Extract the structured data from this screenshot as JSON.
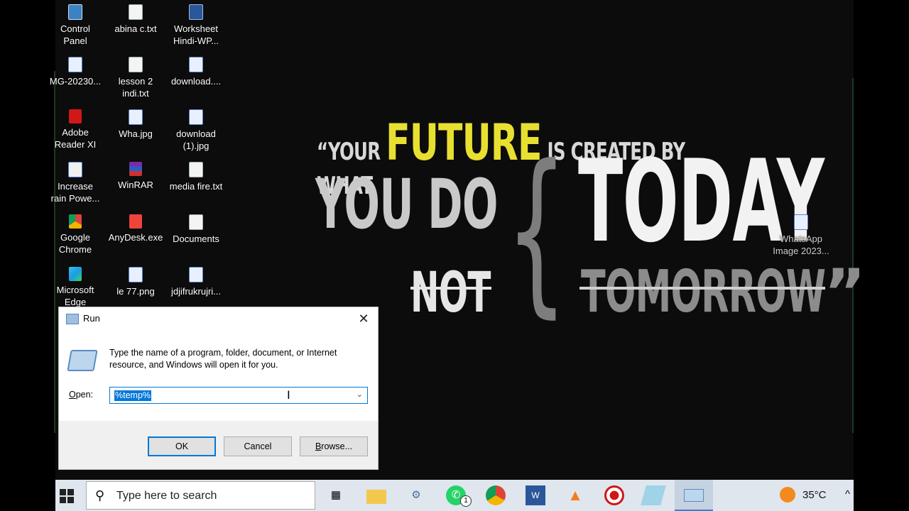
{
  "wallpaper": {
    "open_quote": "“YOUR",
    "future": "FUTURE",
    "created": "IS CREATED BY WHAT",
    "you_do": "YOU DO",
    "brace": "{",
    "today": "TODAY",
    "not": "NOT",
    "tomorrow": "TOMORROW",
    "close_quote": "”",
    "accent_color": "#e8e030"
  },
  "desktop_icons": [
    {
      "label": "Control\nPanel",
      "icon": "control-panel-icon"
    },
    {
      "label": "abina c.txt",
      "icon": "text-file-icon"
    },
    {
      "label": "Worksheet\nHindi-WP...",
      "icon": "word-document-icon"
    },
    {
      "label": "MG-20230...",
      "icon": "image-file-icon"
    },
    {
      "label": "lesson 2\nindi.txt",
      "icon": "text-file-icon"
    },
    {
      "label": "download....",
      "icon": "image-file-icon"
    },
    {
      "label": "Adobe\nReader XI",
      "icon": "adobe-reader-icon"
    },
    {
      "label": "Wha.jpg",
      "icon": "image-file-icon"
    },
    {
      "label": "download\n(1).jpg",
      "icon": "image-file-icon"
    },
    {
      "label": "Increase\nrain Powe...",
      "icon": "bulb-icon"
    },
    {
      "label": "WinRAR",
      "icon": "winrar-icon"
    },
    {
      "label": "media fire.txt",
      "icon": "text-file-icon"
    },
    {
      "label": "Google\nChrome",
      "icon": "chrome-icon"
    },
    {
      "label": "AnyDesk.exe",
      "icon": "anydesk-icon"
    },
    {
      "label": "Documents",
      "icon": "document-icon"
    },
    {
      "label": "Microsoft\nEdge",
      "icon": "edge-icon"
    },
    {
      "label": "le 77.png",
      "icon": "image-file-icon"
    },
    {
      "label": "jdjifrukrujri...",
      "icon": "image-file-icon"
    },
    {
      "label": "WhatsApp\nImage 2023...",
      "icon": "image-file-icon"
    }
  ],
  "run_dialog": {
    "title": "Run",
    "description": "Type the name of a program, folder, document, or Internet resource, and Windows will open it for you.",
    "open_label_accel": "O",
    "open_label_rest": "pen:",
    "open_value": "%temp%",
    "ok_label": "OK",
    "cancel_label": "Cancel",
    "browse_accel": "B",
    "browse_rest": "rowse..."
  },
  "taskbar": {
    "search_placeholder": "Type here to search",
    "temperature": "35°C",
    "whatsapp_badge": "1",
    "apps": [
      "task-view-icon",
      "file-explorer-icon",
      "network-icon",
      "whatsapp-icon",
      "chrome-icon",
      "word-document-icon",
      "vlc-icon",
      "record-icon",
      "notepad-icon",
      "run-icon"
    ]
  }
}
